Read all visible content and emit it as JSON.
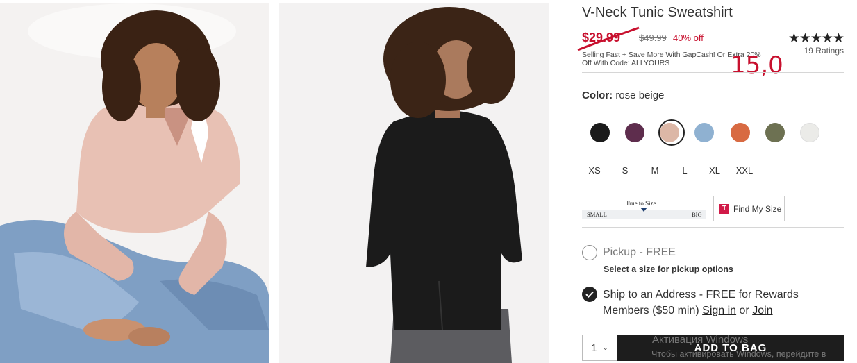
{
  "product": {
    "title": "V-Neck Tunic Sweatshirt",
    "sale_price": "$29.99",
    "original_price": "$49.99",
    "percent_off": "40% off",
    "promo_text": "Selling Fast + Save More With GapCash! Or Extra 20% Off With Code: ALLYOURS",
    "rating_stars": "★★★★★",
    "ratings_count": "19 Ratings",
    "handwritten_note": "15,0"
  },
  "color": {
    "label": "Color:",
    "selected_name": "rose beige",
    "swatches": [
      {
        "name": "black",
        "hex": "#1b1b1b"
      },
      {
        "name": "plum",
        "hex": "#5e2d4d"
      },
      {
        "name": "rose beige",
        "hex": "#dcb7a6"
      },
      {
        "name": "light blue",
        "hex": "#8fb1d1"
      },
      {
        "name": "orange",
        "hex": "#d86a42"
      },
      {
        "name": "olive",
        "hex": "#6d7152"
      },
      {
        "name": "white",
        "hex": "#ebebe8"
      }
    ]
  },
  "sizes": [
    "XS",
    "S",
    "M",
    "L",
    "XL",
    "XXL"
  ],
  "fit": {
    "label": "True to Size",
    "small": "SMALL",
    "big": "BIG",
    "find_my_size": "Find My Size",
    "find_icon": "T"
  },
  "fulfillment": {
    "pickup_label": "Pickup - FREE",
    "pickup_note": "Select a size for pickup options",
    "ship_text": "Ship to an Address - FREE for Rewards Members ($50 min)",
    "sign_in": "Sign in",
    "or": "or",
    "join": "Join"
  },
  "cart": {
    "quantity": "1",
    "add_to_bag": "ADD TO BAG"
  },
  "watermark": {
    "line1": "Активация Windows",
    "line2": "Чтобы активировать Windows, перейдите в"
  },
  "colors": {
    "sale_red": "#c8102e",
    "button_dark": "#1d1d1d"
  }
}
